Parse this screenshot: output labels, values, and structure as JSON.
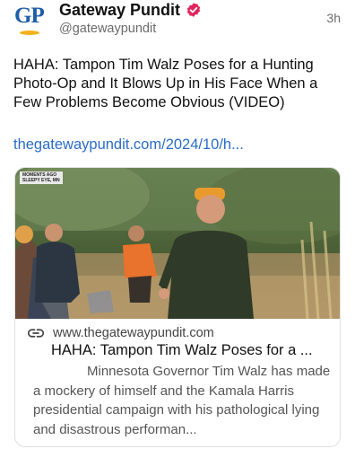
{
  "post": {
    "author_name": "Gateway Pundit",
    "author_handle": "@gatewaypundit",
    "timestamp": "3h",
    "avatar_text": "GP",
    "text": "HAHA: Tampon Tim Walz Poses for a Hunting Photo-Op and It Blows Up in His Face When a Few Problems Become Obvious (VIDEO)",
    "link_text": "thegatewaypundit.com/2024/10/h..."
  },
  "card": {
    "domain": "www.thegatewaypundit.com",
    "title": "HAHA: Tampon Tim Walz Poses for a ...",
    "description": "Minnesota Governor Tim Walz has made a mockery of himself and the Kamala Harris presidential campaign with his pathological lying and disastrous performan...",
    "image_overlay_line1": "MOMENTS AGO",
    "image_overlay_line2": "SLEEPY EYE, MN"
  },
  "colors": {
    "link": "#2a6cc7",
    "verified_badge": "#e0245e",
    "brand_blue": "#1d5ea8",
    "brand_gold": "#f2b21b"
  },
  "icons": [
    "verified-badge-icon",
    "link-chain-icon"
  ]
}
